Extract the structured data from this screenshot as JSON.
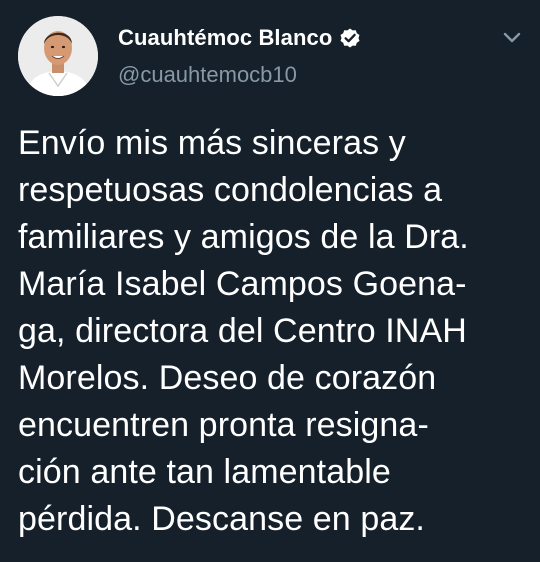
{
  "tweet": {
    "display_name": "Cuauhtémoc Blanco",
    "handle": "@cuauhtemocb10",
    "verified": true,
    "text_lines": [
      "Envío mis más sinceras y",
      "respetuosas condolencias a",
      "familiares y amigos de la Dra.",
      "María Isabel Campos Goena-",
      "ga, directora del Centro INAH",
      "Morelos. Deseo de corazón",
      "encuentren pronta resigna-",
      "ción ante tan lamentable",
      "pérdida. Descanse en paz."
    ]
  },
  "icons": {
    "avatar": "profile-photo",
    "verified_badge": "verified-badge-icon",
    "menu_caret": "chevron-down-icon"
  },
  "colors": {
    "background": "#15202b",
    "name": "#ffffff",
    "handle": "#8899a6",
    "text": "#ffffff",
    "caret": "#8899a6"
  }
}
